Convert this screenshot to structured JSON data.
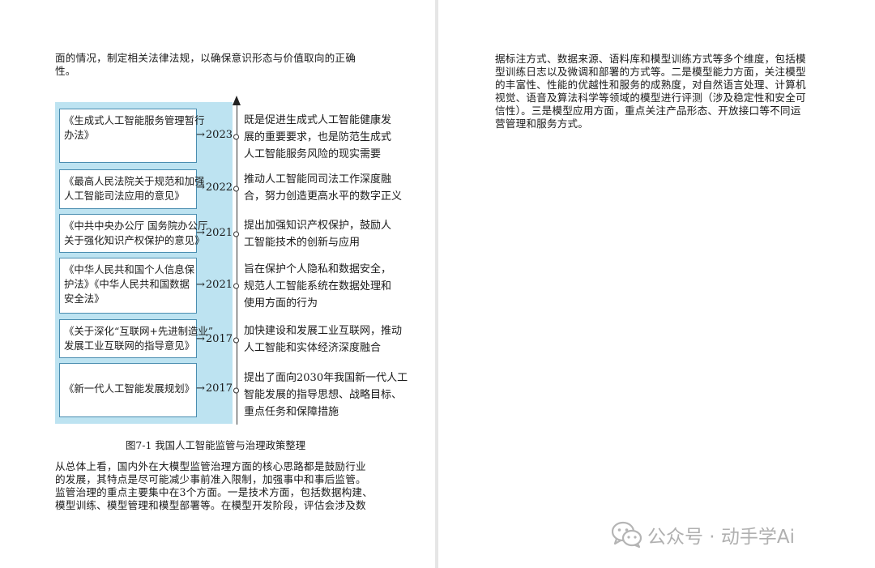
{
  "left_page": {
    "intro_lines": [
      "面的情况，制定相关法律法规，以确保意识形态与价值取向的正确",
      "性。"
    ],
    "figure": {
      "entries": [
        {
          "year": "2023",
          "law_lines": [
            "《生成式人工智能服务管理暂行",
            "办法》"
          ],
          "desc_lines": [
            "既是促进生成式人工智能健康发",
            "展的重要要求，也是防范生成式",
            "人工智能服务风险的现实需要"
          ]
        },
        {
          "year": "2022",
          "law_lines": [
            "《最高人民法院关于规范和加强",
            "人工智能司法应用的意见》"
          ],
          "desc_lines": [
            "推动人工智能同司法工作深度融",
            "合，努力创造更高水平的数字正义"
          ]
        },
        {
          "year": "2021",
          "law_lines": [
            "《中共中央办公厅  国务院办公厅",
            "关于强化知识产权保护的意见》"
          ],
          "desc_lines": [
            "提出加强知识产权保护，鼓励人",
            "工智能技术的创新与应用"
          ]
        },
        {
          "year": "2021",
          "law_lines": [
            "《中华人民共和国个人信息保",
            "护法》《中华人民共和国数据",
            "安全法》"
          ],
          "desc_lines": [
            "旨在保护个人隐私和数据安全，",
            "规范人工智能系统在数据处理和",
            "使用方面的行为"
          ]
        },
        {
          "year": "2017",
          "law_lines": [
            "《关于深化“互联网+先进制造业”",
            "发展工业互联网的指导意见》"
          ],
          "desc_lines": [
            "加快建设和发展工业互联网，推动",
            "人工智能和实体经济深度融合"
          ]
        },
        {
          "year": "2017",
          "law_lines": [
            "《新一代人工智能发展规划》"
          ],
          "desc_lines": [
            "提出了面向2030年我国新一代人工",
            "智能发展的指导思想、战略目标、",
            "重点任务和保障措施"
          ]
        }
      ],
      "caption": "图7-1 我国人工智能监管与治理政策整理"
    },
    "summary_lines": [
      "从总体上看，国内外在大模型监管治理方面的核心思路都是鼓励行业",
      "的发展，其特点是尽可能减少事前准入限制，加强事中和事后监管。",
      "监管治理的重点主要集中在3个方面。一是技术方面，包括数据构建、",
      "模型训练、模型管理和模型部署等。在模型开发阶段，评估会涉及数"
    ]
  },
  "right_page": {
    "lines": [
      "据标注方式、数据来源、语料库和模型训练方式等多个维度，包括模",
      "型训练日志以及微调和部署的方式等。二是模型能力方面，关注模型",
      "的丰富性、性能的优越性和服务的成熟度，对自然语言处理、计算机",
      "视觉、语音及算法科学等领域的模型进行评测（涉及稳定性和安全可",
      "信性）。三是模型应用方面，重点关注产品形态、开放接口等不同运",
      "营管理和服务方式。"
    ]
  },
  "watermark": {
    "icon": "wechat-icon",
    "text": "公众号 · 动手学Ai"
  }
}
